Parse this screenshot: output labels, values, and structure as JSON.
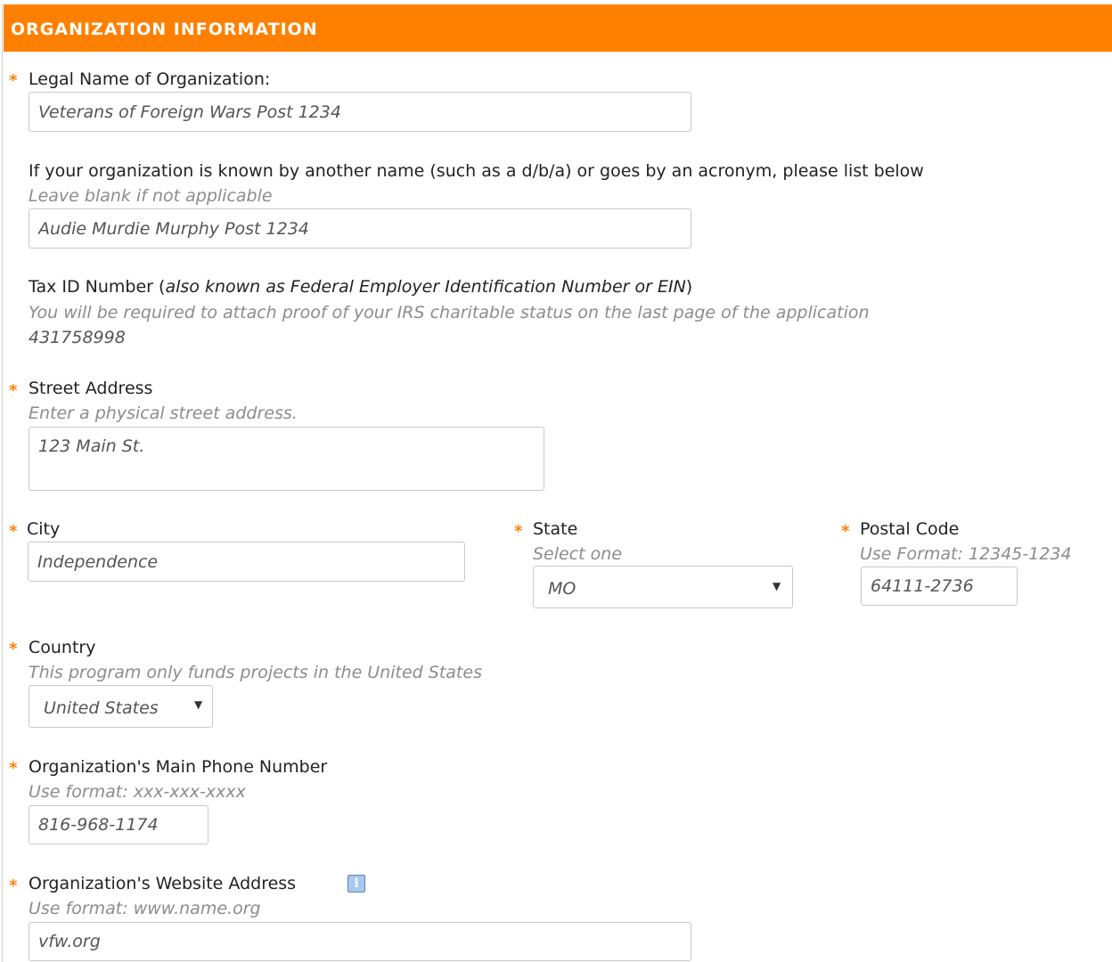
{
  "header": {
    "title": "ORGANIZATION INFORMATION"
  },
  "required_marker": "*",
  "legal_name": {
    "label": "Legal Name of Organization:",
    "value": "Veterans of Foreign Wars Post 1234"
  },
  "alias": {
    "label": "If your organization is known by another name (such as a d/b/a) or goes by an acronym, please list below",
    "hint": "Leave blank if not applicable",
    "value": "Audie Murdie Murphy Post 1234"
  },
  "tax_id": {
    "label": "Tax ID Number (",
    "label_italic": "also known as Federal Employer Identification Number or EIN",
    "label_end": ")",
    "hint": "You will be required to attach proof of your IRS charitable status on the last page of the application",
    "value": "431758998"
  },
  "street": {
    "label": "Street Address",
    "hint": "Enter a physical street address.",
    "value": "123 Main St."
  },
  "city": {
    "label": "City",
    "value": "Independence"
  },
  "state": {
    "label": "State",
    "hint": "Select one",
    "value": "MO"
  },
  "postal": {
    "label": "Postal Code",
    "hint": "Use Format: 12345-1234",
    "value": "64111-2736"
  },
  "country": {
    "label": "Country",
    "hint": "This program only funds projects in the United States",
    "value": "United States"
  },
  "phone": {
    "label": "Organization's Main Phone Number",
    "hint": "Use format: xxx-xxx-xxxx",
    "value": "816-968-1174"
  },
  "website": {
    "label": "Organization's Website Address",
    "hint": "Use format: www.name.org",
    "value": "vfw.org",
    "info_glyph": "i"
  },
  "caret_glyph": "▼",
  "colors": {
    "accent": "#ff8000",
    "hint_text": "#8c8c8c",
    "field_border": "#c8c8c8"
  }
}
